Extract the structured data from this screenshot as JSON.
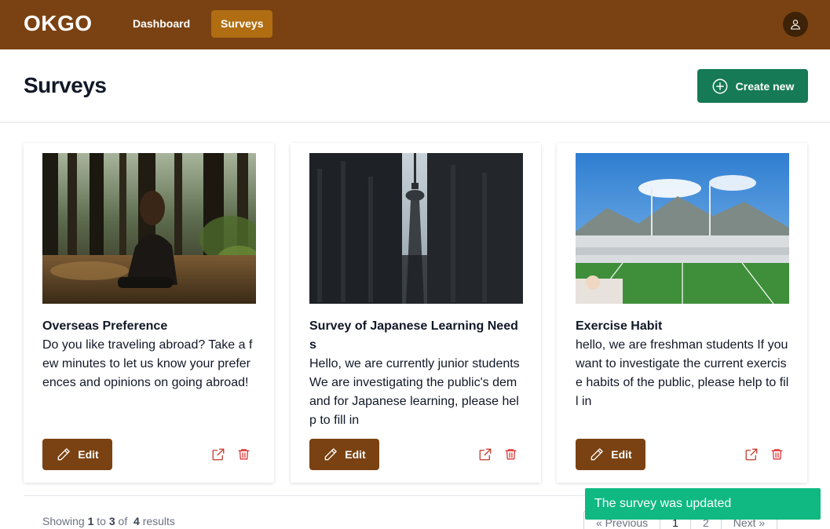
{
  "app": {
    "logo": "OKGO"
  },
  "nav": {
    "items": [
      {
        "label": "Dashboard",
        "active": false
      },
      {
        "label": "Surveys",
        "active": true
      }
    ]
  },
  "header": {
    "title": "Surveys",
    "create_label": "Create new"
  },
  "surveys": [
    {
      "title": "Overseas Preference",
      "description": "Do you like traveling abroad? Take a few minutes to let us know your preferences and opinions on going abroad!",
      "image": "forest-person-photo",
      "edit_label": "Edit"
    },
    {
      "title": "Survey of Japanese Learning Needs",
      "description": "Hello, we are currently junior students We are investigating the public's demand for Japanese learning, please help to fill in",
      "image": "cn-tower-photo",
      "edit_label": "Edit"
    },
    {
      "title": "Exercise Habit",
      "description": "hello, we are freshman students If you want to investigate the current exercise habits of the public, please help to fill in",
      "image": "stadium-photo",
      "edit_label": "Edit"
    }
  ],
  "pagination": {
    "showing_prefix": "Showing ",
    "from": "1",
    "to_word": " to ",
    "to": "3",
    "of_word": " of  ",
    "total": "4",
    "results_word": " results",
    "previous": "« Previous",
    "pages": [
      "1",
      "2"
    ],
    "next": "Next »"
  },
  "toast": {
    "message": "The survey was updated"
  },
  "colors": {
    "brand": "#7a4212",
    "nav_active": "#b06d12",
    "create": "#157a55",
    "delete": "#dc2626",
    "toast": "#10b981"
  },
  "icons": [
    "user-icon",
    "plus-circle-icon",
    "pencil-icon",
    "external-link-icon",
    "trash-icon"
  ]
}
